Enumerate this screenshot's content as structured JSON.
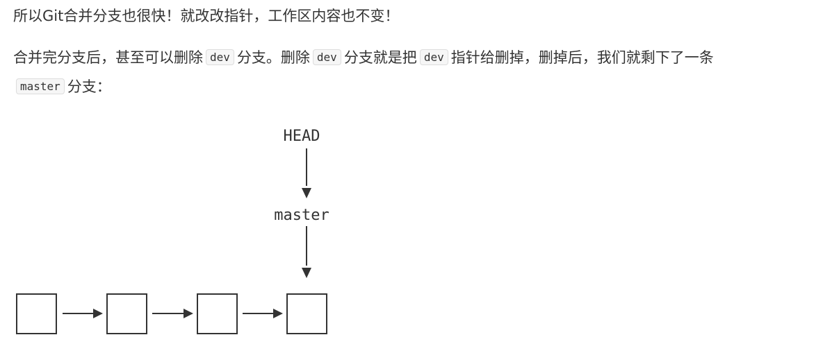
{
  "paragraph1": {
    "text": "所以Git合并分支也很快！就改改指针，工作区内容也不变！"
  },
  "paragraph2": {
    "t1": "合并完分支后，甚至可以删除",
    "code1": "dev",
    "t2": "分支。删除",
    "code2": "dev",
    "t3": "分支就是把",
    "code3": "dev",
    "t4": "指针给删掉，删掉后，我们就剩下了一条",
    "code4": "master",
    "t5": "分支："
  },
  "diagram": {
    "head_label": "HEAD",
    "master_label": "master",
    "commit_count": 4,
    "line_color": "#333333"
  }
}
